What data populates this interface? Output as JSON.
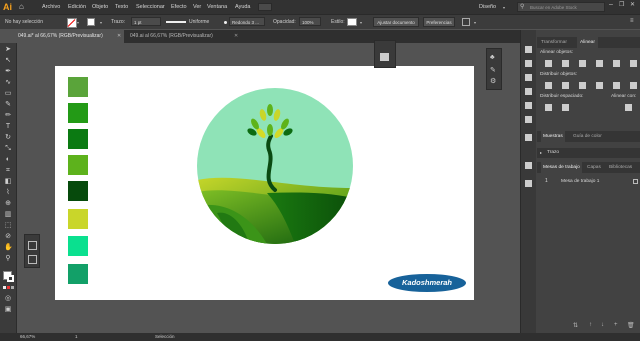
{
  "app": {
    "logo": "Ai",
    "workspace": "Diseño",
    "search_placeholder": "Buscar en Adobe Stock"
  },
  "menu": [
    "Archivo",
    "Edición",
    "Objeto",
    "Texto",
    "Seleccionar",
    "Efecto",
    "Ver",
    "Ventana",
    "Ayuda"
  ],
  "control_bar": {
    "selection_label": "No hay selección",
    "stroke_label": "Trazo:",
    "stroke_value": "1 pt",
    "profile_value": "Uniforme",
    "brush_value": "Redondo 3 ...",
    "opacity_label": "Opacidad:",
    "opacity_value": "100%",
    "style_label": "Estilo:",
    "ajustar_label": "Ajustar documento",
    "preferencias_label": "Preferencias"
  },
  "doc_tabs": [
    {
      "label": "049.ai* al 66,67% (RGB/Previsualizar)",
      "active": true
    },
    {
      "label": "049.ai al 66,67% (RGB/Previsualizar)",
      "active": false
    }
  ],
  "artwork": {
    "swatches": [
      "#5aa43a",
      "#239a16",
      "#0b7a12",
      "#5db21c",
      "#064a0c",
      "#c9d62a",
      "#0ae08f",
      "#12a068"
    ],
    "brand_text": "Kadoshmerah"
  },
  "right_panel": {
    "tabs": [
      "Transformar",
      "Alinear"
    ],
    "align_objects_label": "Alinear objetos:",
    "distribute_objects_label": "Distribuir objetos:",
    "distribute_spacing_label": "Distribuir espaciado:",
    "align_to_label": "Alinear con:",
    "swatch_tabs": [
      "Muestras",
      "Guía de color"
    ],
    "stroke_panel_label": "Trazo",
    "artboard_tabs": [
      "Mesas de trabajo",
      "Capas",
      "Bibliotecas"
    ],
    "artboard_row": {
      "index": "1",
      "name": "Mesa de trabajo 1"
    }
  },
  "status": {
    "zoom": "66,67%",
    "page": "1",
    "mode": "Selección"
  }
}
